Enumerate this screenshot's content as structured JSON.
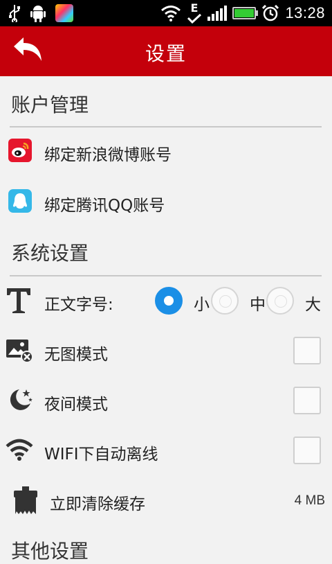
{
  "status_bar": {
    "time": "13:28",
    "network_label": "E",
    "icons": [
      "usb-icon",
      "android-debug-icon",
      "app-notification-icon",
      "wifi-icon",
      "data-e-icon",
      "signal-icon",
      "battery-icon",
      "alarm-icon"
    ],
    "battery_level": 1.0
  },
  "header": {
    "title": "设置",
    "back_icon": "back-arrow-icon",
    "color": "#c4000b"
  },
  "account_section": {
    "title": "账户管理",
    "items": [
      {
        "label": "绑定新浪微博账号",
        "icon": "weibo-icon"
      },
      {
        "label": "绑定腾讯QQ账号",
        "icon": "qq-icon"
      }
    ]
  },
  "system_section": {
    "title": "系统设置",
    "font_size": {
      "label": "正文字号:",
      "icon": "text-size-icon",
      "options": [
        "小",
        "中",
        "大"
      ],
      "selected": "小"
    },
    "toggles": [
      {
        "label": "无图模式",
        "icon": "no-image-icon",
        "checked": false
      },
      {
        "label": "夜间模式",
        "icon": "night-mode-icon",
        "checked": false
      },
      {
        "label": "WIFI下自动离线",
        "icon": "wifi-offline-icon",
        "checked": false
      }
    ],
    "cache": {
      "label": "立即清除缓存",
      "icon": "broom-icon",
      "size": "4 MB"
    }
  },
  "other_section": {
    "title": "其他设置"
  },
  "colors": {
    "accent": "#1b8fe6",
    "header_red": "#c4000b",
    "background": "#f2f2f2"
  }
}
